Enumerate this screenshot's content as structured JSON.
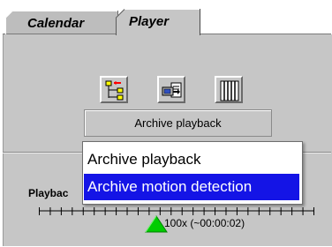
{
  "tabs": [
    {
      "label": "Calendar",
      "selected": false
    },
    {
      "label": "Player",
      "selected": true
    }
  ],
  "toolbar": {
    "buttons": [
      {
        "icon": "tree-hierarchy-icon"
      },
      {
        "icon": "export-icon"
      },
      {
        "icon": "filmstrip-icon"
      }
    ]
  },
  "mode_select": {
    "selected": "Archive playback",
    "options": [
      "Archive playback",
      "Archive motion detection"
    ],
    "highlighted_option": "Archive motion detection"
  },
  "playback": {
    "label": "Playbac",
    "speed_value": "100x (~00:00:02)",
    "slider_color": "#00cc00"
  },
  "colors": {
    "panel": "#c6c6c6",
    "highlight": "#1414e6"
  }
}
